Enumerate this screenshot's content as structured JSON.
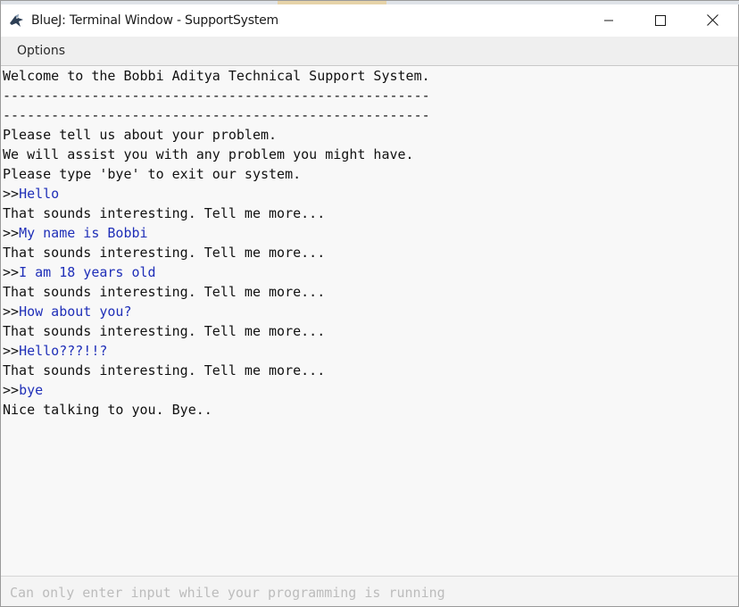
{
  "window": {
    "title": "BlueJ: Terminal Window - SupportSystem",
    "icon": "bluej-bird-icon",
    "controls": [
      "minimize-icon",
      "maximize-icon",
      "close-icon"
    ]
  },
  "menubar": {
    "items": [
      {
        "label": "Options"
      }
    ]
  },
  "terminal": {
    "lines": [
      {
        "type": "output",
        "text": "Welcome to the Bobbi Aditya Technical Support System."
      },
      {
        "type": "output",
        "text": "-----------------------------------------------------"
      },
      {
        "type": "output",
        "text": "-----------------------------------------------------"
      },
      {
        "type": "output",
        "text": "Please tell us about your problem."
      },
      {
        "type": "output",
        "text": "We will assist you with any problem you might have."
      },
      {
        "type": "output",
        "text": "Please type 'bye' to exit our system."
      },
      {
        "type": "input",
        "prompt": ">>",
        "text": "Hello"
      },
      {
        "type": "output",
        "text": "That sounds interesting. Tell me more..."
      },
      {
        "type": "input",
        "prompt": ">>",
        "text": "My name is Bobbi"
      },
      {
        "type": "output",
        "text": "That sounds interesting. Tell me more..."
      },
      {
        "type": "input",
        "prompt": ">>",
        "text": "I am 18 years old"
      },
      {
        "type": "output",
        "text": "That sounds interesting. Tell me more..."
      },
      {
        "type": "input",
        "prompt": ">>",
        "text": "How about you?"
      },
      {
        "type": "output",
        "text": "That sounds interesting. Tell me more..."
      },
      {
        "type": "input",
        "prompt": ">>",
        "text": "Hello???!!?"
      },
      {
        "type": "output",
        "text": "That sounds interesting. Tell me more..."
      },
      {
        "type": "input",
        "prompt": ">>",
        "text": "bye"
      },
      {
        "type": "output",
        "text": "Nice talking to you. Bye.."
      }
    ]
  },
  "input": {
    "value": "",
    "placeholder": "Can only enter input while your programming is running"
  },
  "colors": {
    "input_text": "#1f2fb8",
    "output_text": "#111111",
    "terminal_bg": "#f8f8f8"
  }
}
